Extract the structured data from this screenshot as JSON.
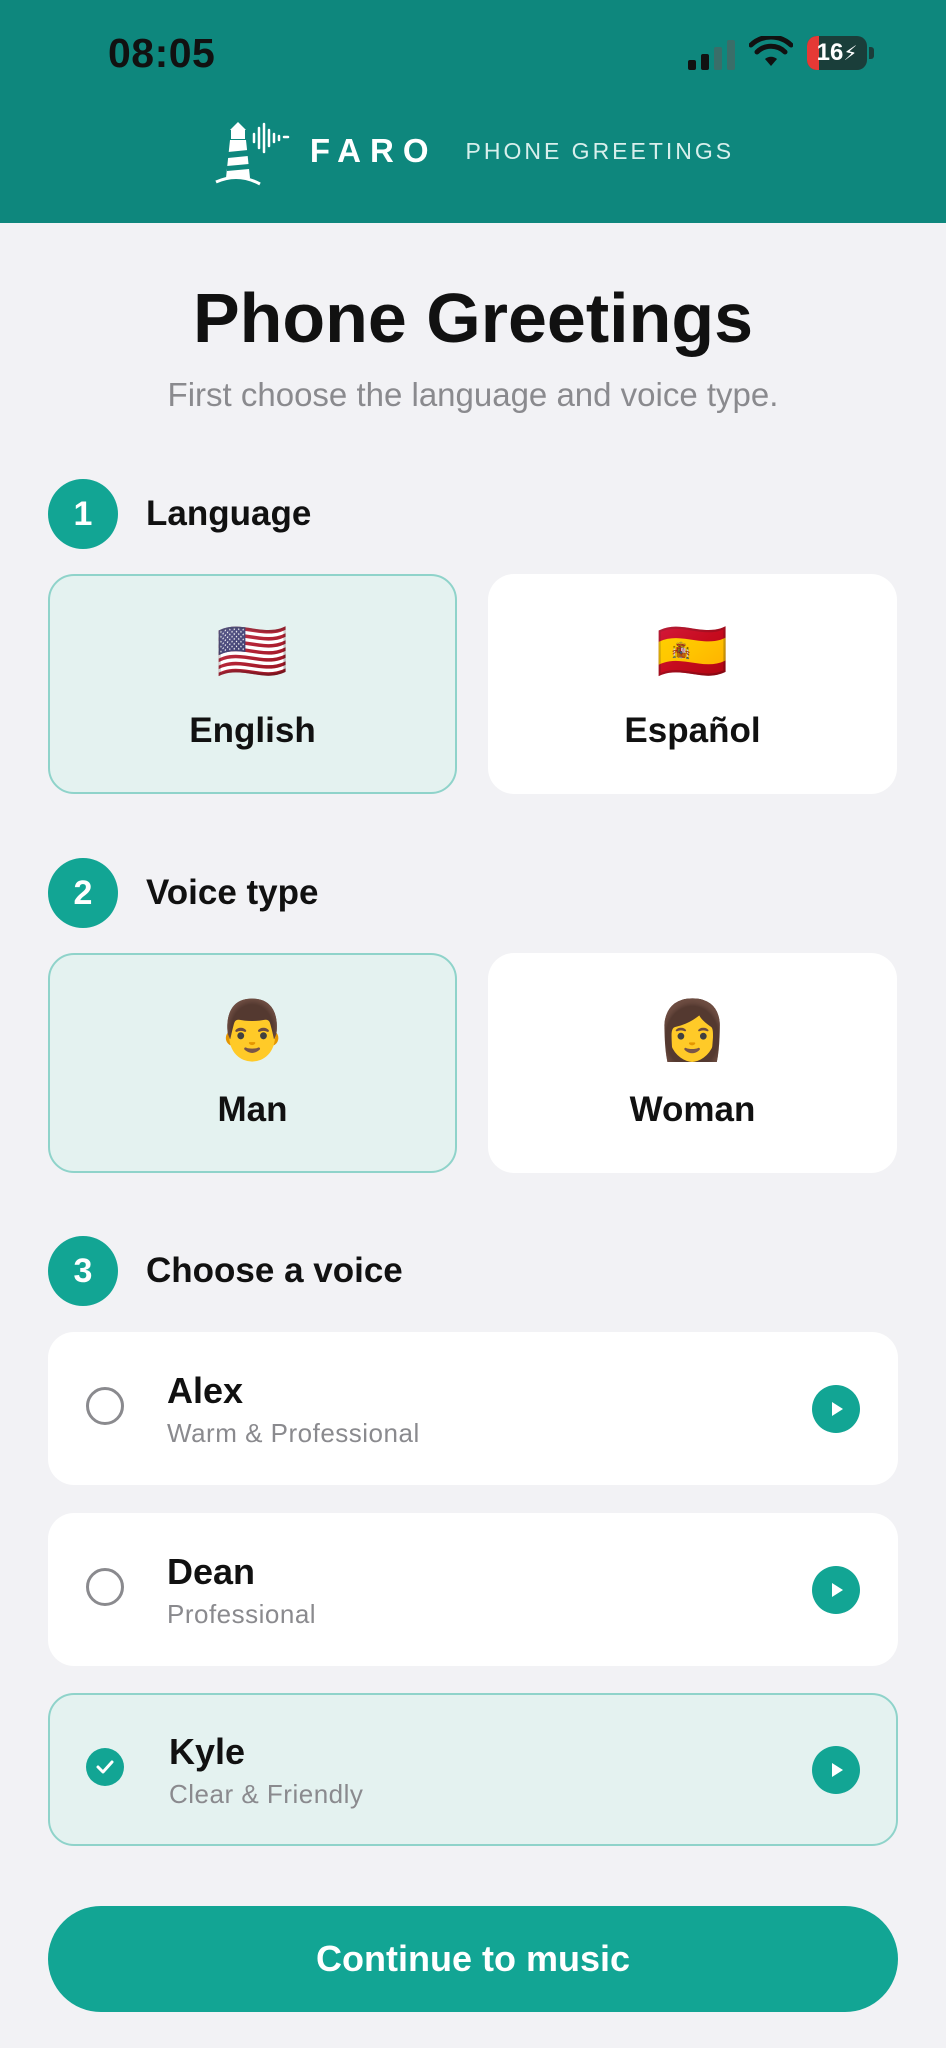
{
  "status_bar": {
    "time": "08:05",
    "battery": "16"
  },
  "brand": {
    "name": "FARO",
    "subtitle": "PHONE GREETINGS"
  },
  "page": {
    "title": "Phone Greetings",
    "subtitle": "First choose the language and voice type."
  },
  "steps": [
    {
      "number": "1",
      "label": "Language"
    },
    {
      "number": "2",
      "label": "Voice type"
    },
    {
      "number": "3",
      "label": "Choose a voice"
    }
  ],
  "languages": [
    {
      "label": "English",
      "icon": "us-flag-icon",
      "emoji": "🇺🇸",
      "selected": true
    },
    {
      "label": "Español",
      "icon": "spain-flag-icon",
      "emoji": "🇪🇸",
      "selected": false
    }
  ],
  "voice_types": [
    {
      "label": "Man",
      "icon": "man-icon",
      "emoji": "👨",
      "selected": true
    },
    {
      "label": "Woman",
      "icon": "woman-icon",
      "emoji": "👩",
      "selected": false
    }
  ],
  "voices": [
    {
      "name": "Alex",
      "description": "Warm & Professional",
      "selected": false
    },
    {
      "name": "Dean",
      "description": "Professional",
      "selected": false
    },
    {
      "name": "Kyle",
      "description": "Clear & Friendly",
      "selected": true
    }
  ],
  "continue_label": "Continue to music",
  "colors": {
    "header": "#0e877d",
    "accent": "#12a594",
    "selected_bg": "#e4f2f0"
  }
}
